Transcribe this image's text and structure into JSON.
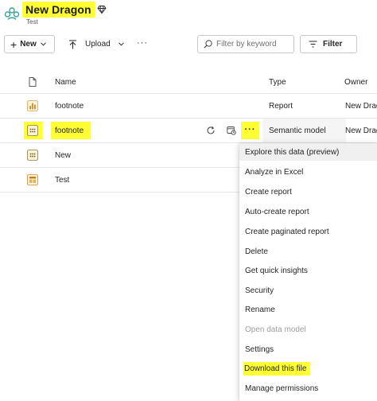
{
  "workspace": {
    "title": "New Dragon",
    "subtitle": "Test",
    "icon": "workspace-icon",
    "badge_icon": "premium-diamond-icon",
    "highlight_color": "#ffff33"
  },
  "toolbar": {
    "new_label": "New",
    "upload_label": "Upload",
    "more_label": "···",
    "search_placeholder": "Filter by keyword",
    "filter_label": "Filter"
  },
  "table": {
    "columns": {
      "name": "Name",
      "type": "Type",
      "owner": "Owner"
    },
    "rows": [
      {
        "name": "footnote",
        "type": "Report",
        "owner": "New Drag",
        "icon": "report-icon"
      },
      {
        "name": "footnote",
        "type": "Semantic model",
        "owner": "New Drag",
        "icon": "semantic-model-icon"
      },
      {
        "name": "New",
        "type": "",
        "owner": "",
        "icon": "semantic-model-icon"
      },
      {
        "name": "Test",
        "type": "",
        "owner": "",
        "icon": "dashboard-icon"
      }
    ],
    "row_more_label": "···"
  },
  "context_menu": {
    "items": [
      {
        "label": "Explore this data (preview)",
        "state": "hover"
      },
      {
        "label": "Analyze in Excel",
        "state": "normal"
      },
      {
        "label": "Create report",
        "state": "normal"
      },
      {
        "label": "Auto-create report",
        "state": "normal"
      },
      {
        "label": "Create paginated report",
        "state": "normal"
      },
      {
        "label": "Delete",
        "state": "normal"
      },
      {
        "label": "Get quick insights",
        "state": "normal"
      },
      {
        "label": "Security",
        "state": "normal"
      },
      {
        "label": "Rename",
        "state": "normal"
      },
      {
        "label": "Open data model",
        "state": "disabled"
      },
      {
        "label": "Settings",
        "state": "normal"
      },
      {
        "label": "Download this file",
        "state": "highlighted"
      },
      {
        "label": "Manage permissions",
        "state": "normal"
      }
    ]
  }
}
